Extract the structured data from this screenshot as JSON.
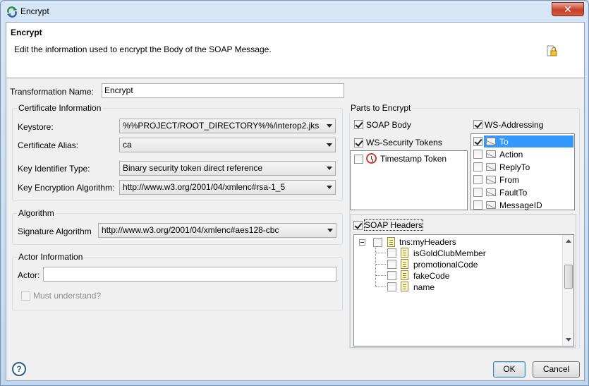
{
  "window": {
    "title": "Encrypt",
    "close_glyph": "✕"
  },
  "banner": {
    "title": "Encrypt",
    "description": "Edit the information used to encrypt the Body  of the SOAP Message."
  },
  "transformation": {
    "label": "Transformation Name:",
    "value": "Encrypt"
  },
  "certificate": {
    "title": "Certificate Information",
    "keystore_label": "Keystore:",
    "keystore_value": "%%PROJECT/ROOT_DIRECTORY%%/interop2.jks",
    "alias_label": "Certificate Alias:",
    "alias_value": "ca",
    "key_id_label": "Key Identifier Type:",
    "key_id_value": "Binary security token direct reference",
    "key_enc_label": "Key Encryption Algorithm:",
    "key_enc_value": "http://www.w3.org/2001/04/xmlenc#rsa-1_5"
  },
  "algorithm": {
    "title": "Algorithm",
    "sig_label": "Signature Algorithm",
    "sig_value": "http://www.w3.org/2001/04/xmlenc#aes128-cbc"
  },
  "actor": {
    "title": "Actor Information",
    "actor_label": "Actor:",
    "actor_value": "",
    "must_understand_label": "Must understand?",
    "must_understand_checked": false
  },
  "parts": {
    "title": "Parts to Encrypt",
    "soap_body": {
      "label": "SOAP Body",
      "checked": true
    },
    "ws_security": {
      "label": "WS-Security Tokens",
      "checked": true
    },
    "timestamp": {
      "label": "Timestamp Token",
      "checked": false
    },
    "ws_addressing": {
      "label": "WS-Addressing",
      "checked": true,
      "items": [
        {
          "label": "To",
          "checked": true,
          "selected": true
        },
        {
          "label": "Action",
          "checked": false
        },
        {
          "label": "ReplyTo",
          "checked": false
        },
        {
          "label": "From",
          "checked": false
        },
        {
          "label": "FaultTo",
          "checked": false
        },
        {
          "label": "MessageID",
          "checked": false
        }
      ]
    },
    "soap_headers": {
      "label": "SOAP Headers",
      "checked": true,
      "root": "tns:myHeaders",
      "children": [
        "isGoldClubMember",
        "promotionalCode",
        "fakeCode",
        "name"
      ]
    }
  },
  "buttons": {
    "ok": "OK",
    "cancel": "Cancel",
    "help": "?"
  },
  "icons": {
    "window": "encrypt-app-icon",
    "banner": "lock-document-icon",
    "help": "help-icon"
  }
}
